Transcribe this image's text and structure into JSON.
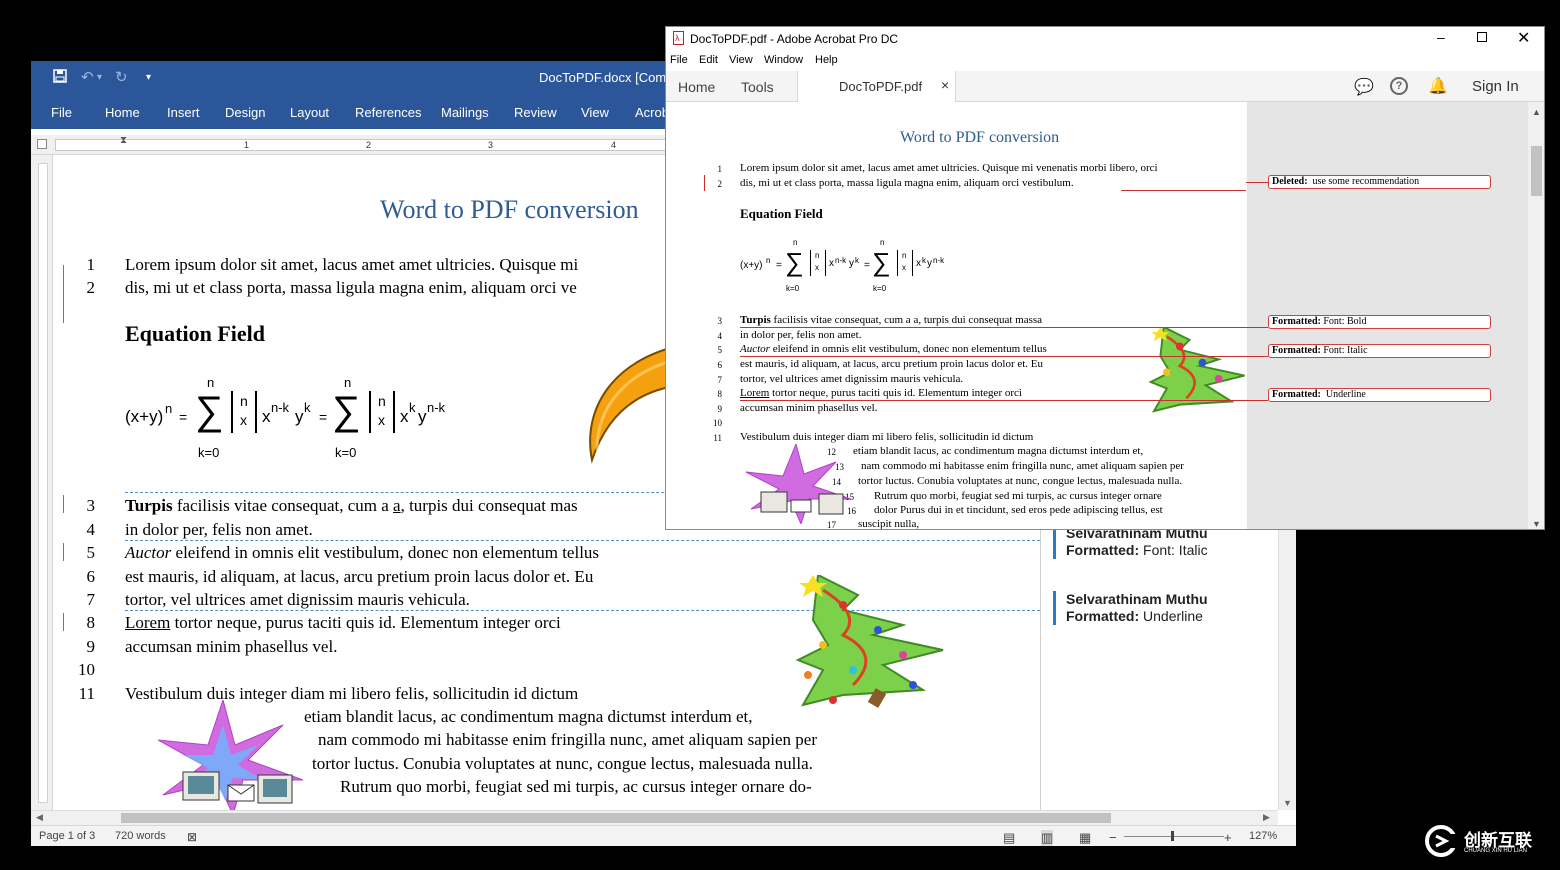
{
  "word": {
    "title": "DocToPDF.docx [Compa",
    "ribbon_tabs": [
      "File",
      "Home",
      "Insert",
      "Design",
      "Layout",
      "References",
      "Mailings",
      "Review",
      "View",
      "Acrob"
    ],
    "ruler_numbers": [
      "1",
      "2",
      "3",
      "4"
    ],
    "doc_title": "Word to PDF conversion",
    "line1": "Lorem ipsum dolor sit amet, lacus amet amet ultricies. Quisque mi",
    "line2": "dis, mi ut et class porta, massa ligula magna enim, aliquam orci ve",
    "heading": "Equation Field",
    "eq": {
      "lhs": "(x+y)",
      "lhs_exp": "n",
      "equals": "=",
      "sum_top": "n",
      "sum_bottom": "k=0",
      "binom_top": "n",
      "binom_bottom": "x",
      "term1_x": "x",
      "term1_x_exp": "n-k",
      "term1_y": "y",
      "term1_y_exp": "k",
      "term2_x": "x",
      "term2_x_exp": "k",
      "term2_y": "y",
      "term2_y_exp": "n-k"
    },
    "line3_bold": "Turpis",
    "line3_a": " facilisis vitae consequat, cum a ",
    "line3_link": "a",
    "line3_b": ", turpis dui consequat mas",
    "line4": "in dolor per, felis non amet.",
    "line5_italic": "Auctor",
    "line5_rest": " eleifend in omnis elit vestibulum, donec non elementum tellus",
    "line6": "est mauris, id aliquam, at lacus, arcu pretium proin lacus dolor et. Eu",
    "line7": "tortor, vel ultrices amet dignissim mauris vehicula.",
    "line8_underline": "Lorem",
    "line8_rest": " tortor neque, purus taciti quis id. Elementum integer orci",
    "line9": "accumsan minim phasellus vel.",
    "line11": "Vestibulum duis integer diam mi libero felis, sollicitudin id dictum",
    "wrap1": "etiam blandit lacus, ac condimentum magna dictumst interdum et,",
    "wrap2": "nam commodo mi habitasse enim fringilla nunc, amet aliquam sapien per",
    "wrap3": "tortor luctus. Conubia voluptates at nunc, congue lectus, malesuada nulla.",
    "wrap4": "Rutrum quo morbi, feugiat sed mi turpis, ac cursus integer ornare do-",
    "comments": [
      {
        "author": "Selvarathinam Muthu",
        "label": "Formatted:",
        "value": "Font: Italic"
      },
      {
        "author": "Selvarathinam Muthu",
        "label": "Formatted:",
        "value": "Underline"
      }
    ],
    "status": {
      "page": "Page 1 of 3",
      "words": "720 words",
      "zoom": "127%"
    }
  },
  "acrobat": {
    "title": "DocToPDF.pdf - Adobe Acrobat Pro DC",
    "menu": [
      "File",
      "Edit",
      "View",
      "Window",
      "Help"
    ],
    "tab_home": "Home",
    "tab_tools": "Tools",
    "doc_tab": "DocToPDF.pdf",
    "close_glyph": "×",
    "sign_in": "Sign In",
    "pdf": {
      "title": "Word to PDF conversion",
      "heading": "Equation Field",
      "eq_lhs": "(x+y)",
      "eq_lhs_exp": "n",
      "line1": "Lorem ipsum dolor sit amet, lacus amet amet ultricies. Quisque mi venenatis morbi libero, orci",
      "line2": "dis, mi ut et class porta, massa ligula magna enim, aliquam orci vestibulum.",
      "line3_bold": "Turpis",
      "line3_rest": " facilisis vitae consequat, cum a a, turpis dui consequat massa",
      "line4": "in dolor per, felis non amet.",
      "line5_italic": "Auctor",
      "line5_rest": " eleifend in omnis elit vestibulum, donec non elementum tellus",
      "line6": "est mauris, id aliquam, at lacus, arcu pretium proin lacus dolor et. Eu",
      "line7": "tortor, vel ultrices amet dignissim mauris vehicula.",
      "line8_underline": "Lorem",
      "line8_rest": " tortor neque, purus taciti quis id. Elementum integer orci",
      "line9": "accumsan minim phasellus vel.",
      "line11": "Vestibulum duis integer diam mi libero felis, sollicitudin id dictum",
      "wrap1": "etiam blandit lacus, ac condimentum magna dictumst interdum et,",
      "wrap2": "nam commodo mi habitasse enim fringilla nunc, amet aliquam sapien per",
      "wrap3": "tortor luctus. Conubia voluptates at nunc, congue lectus, malesuada nulla.",
      "wrap4": "Rutrum quo morbi, feugiat sed mi turpis, ac cursus integer ornare",
      "wrap5": "dolor Purus dui in et tincidunt, sed eros pede adipiscing tellus, est",
      "wrap6": "suscipit nulla,"
    },
    "annotations": [
      {
        "label": "Deleted:",
        "value": "use some recommendation"
      },
      {
        "label": "Formatted:",
        "value": "Font:  Bold"
      },
      {
        "label": "Formatted:",
        "value": "Font:  Italic"
      },
      {
        "label": "Formatted:",
        "value": "Underline"
      }
    ]
  },
  "line_numbers": [
    "1",
    "2",
    "3",
    "4",
    "5",
    "6",
    "7",
    "8",
    "9",
    "10",
    "11",
    "12",
    "13",
    "14",
    "15",
    "16",
    "17"
  ],
  "watermark": {
    "cn": "创新互联",
    "en": "CHUANG XIN HU LIAN"
  },
  "colors": {
    "word_blue": "#2b579a",
    "heading_blue": "#2e5c93",
    "arrow_orange": "#f5a00f",
    "revision_red": "#c83030",
    "comment_blue": "#2b7bc2"
  }
}
